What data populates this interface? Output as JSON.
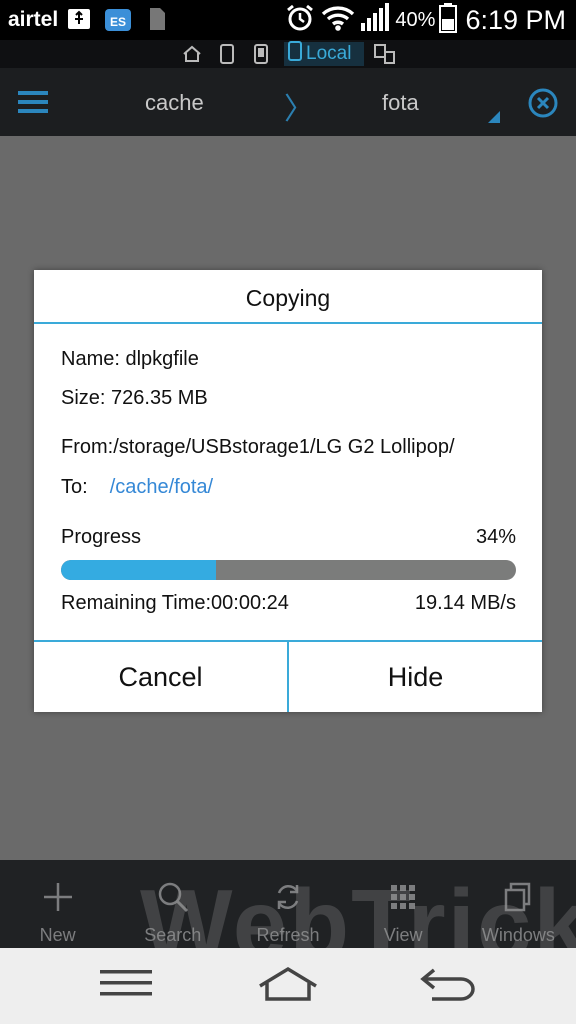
{
  "status_bar": {
    "carrier": "airtel",
    "battery_percent": "40%",
    "time": "6:19 PM",
    "icons": [
      "usb-icon",
      "es-app-icon",
      "sim-icon",
      "alarm-icon",
      "wifi-icon",
      "signal-icon",
      "battery-icon"
    ]
  },
  "location_bar": {
    "icons": [
      "home-icon",
      "phone-icon",
      "tablet-icon",
      "local-storage-icon",
      "network-icon"
    ],
    "active_label": "Local"
  },
  "header": {
    "crumbs": [
      "cache",
      "fota"
    ],
    "separator": "〉",
    "icons": [
      "menu-icon",
      "close-icon"
    ]
  },
  "dialog": {
    "title": "Copying",
    "name_line": "Name: dlpkgfile",
    "size_line": "Size: 726.35 MB",
    "from_line": "From:/storage/USBstorage1/LG G2 Lollipop/",
    "to_label": "To:",
    "to_path": "/cache/fota/",
    "progress_label": "Progress",
    "progress_percent": "34%",
    "progress_value": 0.34,
    "remaining_line": "Remaining Time:00:00:24",
    "speed": "19.14 MB/s",
    "cancel_label": "Cancel",
    "hide_label": "Hide"
  },
  "toolbar": {
    "items": [
      {
        "label": "New",
        "icon": "plus-icon"
      },
      {
        "label": "Search",
        "icon": "search-icon"
      },
      {
        "label": "Refresh",
        "icon": "refresh-icon"
      },
      {
        "label": "View",
        "icon": "grid-icon"
      },
      {
        "label": "Windows",
        "icon": "windows-icon"
      }
    ]
  },
  "watermark": "WebTrickz",
  "nav_bar": {
    "icons": [
      "nav-menu-icon",
      "nav-home-icon",
      "nav-back-icon"
    ]
  },
  "colors": {
    "accent": "#3aaad9",
    "progress_fill": "#34abe1",
    "link": "#3588d6",
    "overlay": "#6a6a6a"
  }
}
